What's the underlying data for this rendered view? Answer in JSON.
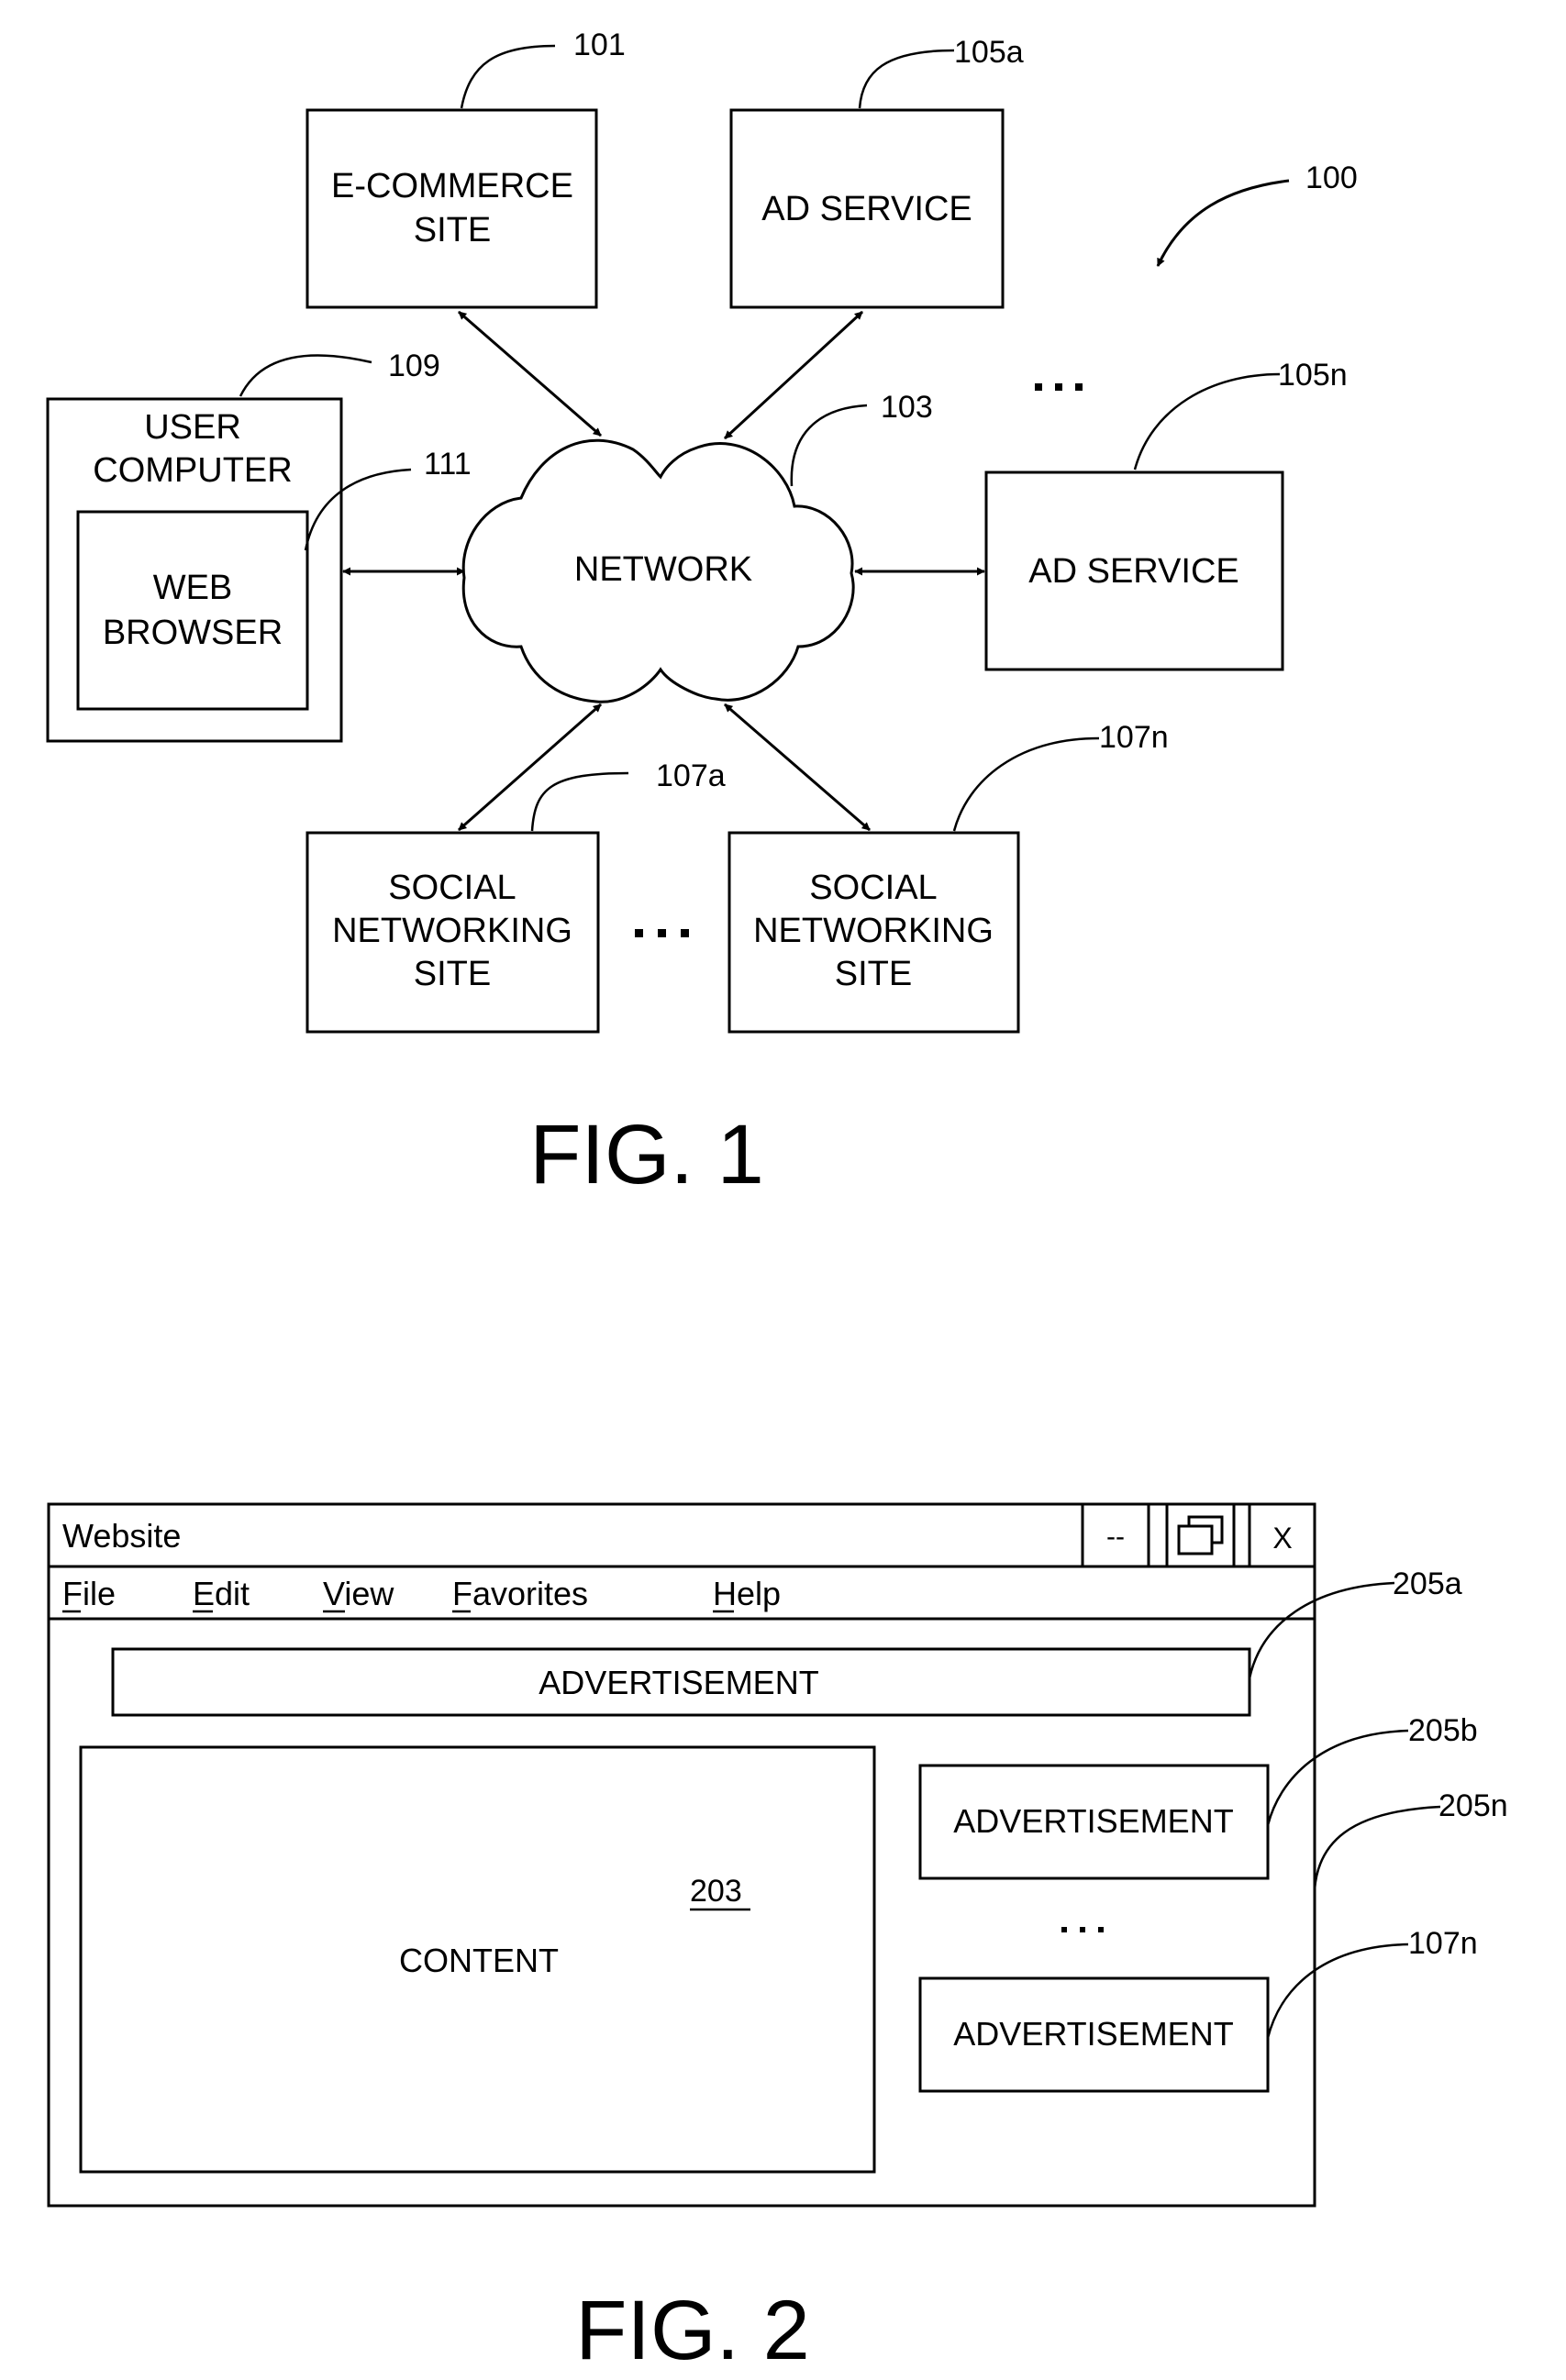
{
  "figure1": {
    "caption": "FIG. 1",
    "system_ref": "100",
    "nodes": {
      "ecommerce": {
        "lines": [
          "E-COMMERCE",
          "SITE"
        ],
        "ref": "101"
      },
      "ad_service_a": {
        "lines": [
          "AD SERVICE"
        ],
        "ref": "105a"
      },
      "ad_service_n": {
        "lines": [
          "AD SERVICE"
        ],
        "ref": "105n"
      },
      "network": {
        "lines": [
          "NETWORK"
        ],
        "ref": "103"
      },
      "user_computer": {
        "lines": [
          "USER",
          "COMPUTER"
        ],
        "ref": "109"
      },
      "web_browser": {
        "lines": [
          "WEB",
          "BROWSER"
        ],
        "ref": "111"
      },
      "social_a": {
        "lines": [
          "SOCIAL",
          "NETWORKING",
          "SITE"
        ],
        "ref": "107a"
      },
      "social_n": {
        "lines": [
          "SOCIAL",
          "NETWORKING",
          "SITE"
        ],
        "ref": "107n"
      }
    },
    "connections": [
      {
        "from": "ecommerce",
        "to": "network",
        "type": "bidirectional"
      },
      {
        "from": "ad_service_a",
        "to": "network",
        "type": "bidirectional"
      },
      {
        "from": "user_computer",
        "to": "network",
        "type": "bidirectional"
      },
      {
        "from": "ad_service_n",
        "to": "network",
        "type": "bidirectional"
      },
      {
        "from": "social_a",
        "to": "network",
        "type": "bidirectional"
      },
      {
        "from": "social_n",
        "to": "network",
        "type": "bidirectional"
      }
    ],
    "ellipsis": "..."
  },
  "figure2": {
    "caption": "FIG. 2",
    "window": {
      "title": "Website",
      "controls": {
        "minimize": "--",
        "maximize": "restore-icon",
        "close": "X"
      },
      "menu": [
        {
          "label": "File",
          "mnemonic": "F"
        },
        {
          "label": "Edit",
          "mnemonic": "E"
        },
        {
          "label": "View",
          "mnemonic": "V"
        },
        {
          "label": "Favorites",
          "mnemonic": "F"
        },
        {
          "label": "Help",
          "mnemonic": "H"
        }
      ]
    },
    "top_ad": {
      "label": "ADVERTISEMENT",
      "ref": "205a"
    },
    "content": {
      "label": "CONTENT",
      "ref": "203"
    },
    "side_ads": [
      {
        "label": "ADVERTISEMENT",
        "ref": "205b"
      },
      {
        "label": "ADVERTISEMENT",
        "ref": "107n"
      }
    ],
    "side_ref_extra": "205n",
    "ellipsis": "..."
  }
}
